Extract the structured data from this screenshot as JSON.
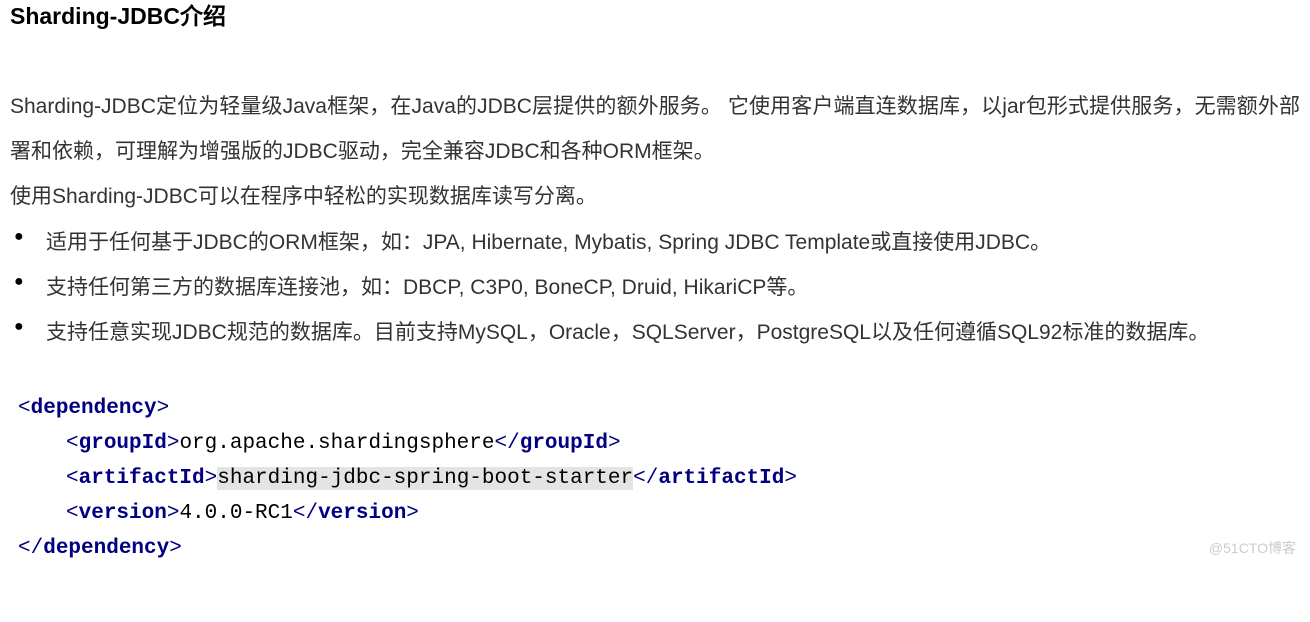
{
  "heading": "Sharding-JDBC介绍",
  "paragraph1": "Sharding-JDBC定位为轻量级Java框架，在Java的JDBC层提供的额外服务。 它使用客户端直连数据库，以jar包形式提供服务，无需额外部署和依赖，可理解为增强版的JDBC驱动，完全兼容JDBC和各种ORM框架。",
  "paragraph2": "使用Sharding-JDBC可以在程序中轻松的实现数据库读写分离。",
  "bullets": [
    "适用于任何基于JDBC的ORM框架，如：JPA, Hibernate, Mybatis, Spring JDBC Template或直接使用JDBC。",
    "支持任何第三方的数据库连接池，如：DBCP, C3P0, BoneCP, Druid, HikariCP等。",
    "支持任意实现JDBC规范的数据库。目前支持MySQL，Oracle，SQLServer，PostgreSQL以及任何遵循SQL92标准的数据库。"
  ],
  "xml": {
    "dependency_open": "dependency",
    "dependency_close": "dependency",
    "groupId_tag": "groupId",
    "groupId_value": "org.apache.shardingsphere",
    "artifactId_tag": "artifactId",
    "artifactId_value": "sharding-jdbc-spring-boot-starter",
    "version_tag": "version",
    "version_value": "4.0.0-RC1"
  },
  "watermark": "@51CTO博客"
}
